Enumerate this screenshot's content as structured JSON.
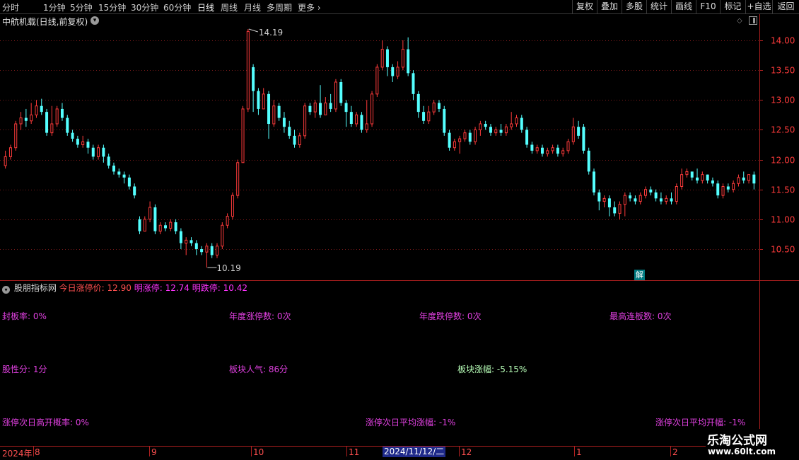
{
  "toolbar": {
    "periods": [
      "分时",
      "1分钟",
      "5分钟",
      "15分钟",
      "30分钟",
      "60分钟",
      "日线",
      "周线",
      "月线",
      "多周期",
      "更多"
    ],
    "active_period": "日线",
    "buttons": [
      "复权",
      "叠加",
      "多股",
      "统计",
      "画线",
      "F10",
      "标记",
      "+自选",
      "返回"
    ]
  },
  "chart": {
    "title": "中航机载(日线,前复权)",
    "high_label": "14.19",
    "low_label": "10.19"
  },
  "indicator": {
    "name": "股朋指标网",
    "today_limit": "今日涨停价: 12.90",
    "tomorrow_limit_up": "明涨停: 12.74",
    "tomorrow_limit_down": "明跌停: 10.42",
    "stats": {
      "seal_rate": "封板率: 0%",
      "annual_limit_up": "年度涨停数: 0次",
      "annual_limit_down": "年度跌停数: 0次",
      "max_consecutive": "最高连板数: 0次",
      "stock_character": "股性分: 1分",
      "sector_popularity": "板块人气: 86分",
      "sector_change": "板块涨幅: -5.15%",
      "next_day_gap_up_rate": "涨停次日高开概率: 0%",
      "next_day_avg_change": "涨停次日平均涨幅: -1%",
      "next_day_avg_open": "涨停次日平均开幅: -1%"
    },
    "badge": "解"
  },
  "time_axis": {
    "labels": [
      "2024年",
      "8",
      "9",
      "10",
      "11",
      "12",
      "1",
      "2"
    ],
    "cursor_date": "2024/11/12/二"
  },
  "watermark": {
    "title": "乐淘公式网",
    "url": "www.60lt.com"
  },
  "colors": {
    "up": "#ff3b3b",
    "down": "#54ffff",
    "axis": "#b02020",
    "grid": "#7a1a1a"
  },
  "chart_data": {
    "type": "candlestick",
    "title": "中航机载(日线,前复权)",
    "ylim": [
      10.0,
      14.3
    ],
    "yticks": [
      10.5,
      11.0,
      11.5,
      12.0,
      12.5,
      13.0,
      13.5,
      14.0
    ],
    "x_month_labels": [
      "2024年",
      "8",
      "9",
      "10",
      "11",
      "12",
      "1",
      "2"
    ],
    "annotations": [
      {
        "text": "14.19",
        "value": 14.19
      },
      {
        "text": "10.19",
        "value": 10.19
      }
    ],
    "candles": [
      [
        11.9,
        12.05,
        11.85,
        12.15
      ],
      [
        12.05,
        12.2,
        12.0,
        12.25
      ],
      [
        12.2,
        12.6,
        12.15,
        12.65
      ],
      [
        12.6,
        12.7,
        12.5,
        12.8
      ],
      [
        12.7,
        12.65,
        12.55,
        12.85
      ],
      [
        12.65,
        12.75,
        12.6,
        12.95
      ],
      [
        12.75,
        12.9,
        12.7,
        13.0
      ],
      [
        12.9,
        12.8,
        12.75,
        13.02
      ],
      [
        12.8,
        12.45,
        12.4,
        12.85
      ],
      [
        12.45,
        12.6,
        12.4,
        12.9
      ],
      [
        12.6,
        12.85,
        12.55,
        12.9
      ],
      [
        12.85,
        12.7,
        12.65,
        12.95
      ],
      [
        12.7,
        12.45,
        12.4,
        12.75
      ],
      [
        12.45,
        12.35,
        12.3,
        12.5
      ],
      [
        12.35,
        12.25,
        12.2,
        12.4
      ],
      [
        12.25,
        12.3,
        12.2,
        12.4
      ],
      [
        12.3,
        12.2,
        12.1,
        12.35
      ],
      [
        12.2,
        12.05,
        12.0,
        12.25
      ],
      [
        12.05,
        12.2,
        12.0,
        12.25
      ],
      [
        12.2,
        12.05,
        11.95,
        12.25
      ],
      [
        12.05,
        11.9,
        11.85,
        12.1
      ],
      [
        11.9,
        11.8,
        11.75,
        11.95
      ],
      [
        11.8,
        11.75,
        11.7,
        11.85
      ],
      [
        11.75,
        11.7,
        11.6,
        11.8
      ],
      [
        11.7,
        11.55,
        11.5,
        11.75
      ],
      [
        11.55,
        11.4,
        11.35,
        11.6
      ],
      [
        11.0,
        10.8,
        10.75,
        11.05
      ],
      [
        10.8,
        11.0,
        10.8,
        11.05
      ],
      [
        11.0,
        11.2,
        10.95,
        11.3
      ],
      [
        11.2,
        10.8,
        10.75,
        11.25
      ],
      [
        10.8,
        10.9,
        10.75,
        10.95
      ],
      [
        10.9,
        10.85,
        10.8,
        10.95
      ],
      [
        10.85,
        10.95,
        10.8,
        11.0
      ],
      [
        10.95,
        10.8,
        10.75,
        11.0
      ],
      [
        10.8,
        10.6,
        10.5,
        10.85
      ],
      [
        10.6,
        10.65,
        10.4,
        10.7
      ],
      [
        10.65,
        10.6,
        10.55,
        10.7
      ],
      [
        10.6,
        10.5,
        10.4,
        10.65
      ],
      [
        10.5,
        10.45,
        10.4,
        10.55
      ],
      [
        10.45,
        10.55,
        10.19,
        10.6
      ],
      [
        10.55,
        10.4,
        10.35,
        10.6
      ],
      [
        10.4,
        10.55,
        10.35,
        10.6
      ],
      [
        10.55,
        10.9,
        10.5,
        10.95
      ],
      [
        10.9,
        11.05,
        10.85,
        11.1
      ],
      [
        11.05,
        11.4,
        11.0,
        11.45
      ],
      [
        11.4,
        11.95,
        11.35,
        12.0
      ],
      [
        11.95,
        12.85,
        12.4,
        12.9
      ],
      [
        12.85,
        14.15,
        12.8,
        14.19
      ],
      [
        13.55,
        13.15,
        12.8,
        13.6
      ],
      [
        13.15,
        12.85,
        12.75,
        13.2
      ],
      [
        12.85,
        13.1,
        12.85,
        13.2
      ],
      [
        13.1,
        12.6,
        12.35,
        13.15
      ],
      [
        12.6,
        12.9,
        12.55,
        13.0
      ],
      [
        12.9,
        12.7,
        12.65,
        12.95
      ],
      [
        12.7,
        12.55,
        12.45,
        12.8
      ],
      [
        12.55,
        12.4,
        12.35,
        12.65
      ],
      [
        12.4,
        12.25,
        12.2,
        12.5
      ],
      [
        12.25,
        12.4,
        12.2,
        12.45
      ],
      [
        12.4,
        12.9,
        12.35,
        12.95
      ],
      [
        12.9,
        12.8,
        12.75,
        12.95
      ],
      [
        12.8,
        12.95,
        12.7,
        13.0
      ],
      [
        12.95,
        12.75,
        12.7,
        13.25
      ],
      [
        12.75,
        12.95,
        12.75,
        13.05
      ],
      [
        12.95,
        12.85,
        12.8,
        13.1
      ],
      [
        12.85,
        13.3,
        12.8,
        13.35
      ],
      [
        13.3,
        12.95,
        12.9,
        13.35
      ],
      [
        12.95,
        12.8,
        12.55,
        13.0
      ],
      [
        12.8,
        12.6,
        12.55,
        12.9
      ],
      [
        12.6,
        12.75,
        12.55,
        12.8
      ],
      [
        12.75,
        12.5,
        12.45,
        12.8
      ],
      [
        12.5,
        12.6,
        12.45,
        13.0
      ],
      [
        12.6,
        13.1,
        12.55,
        13.15
      ],
      [
        13.1,
        13.55,
        13.05,
        13.6
      ],
      [
        13.55,
        13.85,
        13.5,
        14.0
      ],
      [
        13.85,
        13.55,
        13.4,
        13.9
      ],
      [
        13.55,
        13.4,
        13.3,
        13.6
      ],
      [
        13.4,
        13.55,
        13.35,
        13.65
      ],
      [
        13.55,
        13.85,
        13.5,
        14.0
      ],
      [
        13.85,
        13.45,
        13.4,
        14.05
      ],
      [
        13.45,
        13.1,
        13.0,
        13.5
      ],
      [
        13.1,
        12.8,
        12.7,
        13.15
      ],
      [
        12.8,
        12.65,
        12.6,
        12.9
      ],
      [
        12.65,
        12.8,
        12.6,
        12.9
      ],
      [
        12.8,
        12.95,
        12.75,
        13.0
      ],
      [
        12.95,
        12.85,
        12.8,
        13.0
      ],
      [
        12.85,
        12.45,
        12.4,
        12.9
      ],
      [
        12.45,
        12.2,
        12.15,
        12.5
      ],
      [
        12.2,
        12.3,
        12.15,
        12.35
      ],
      [
        12.3,
        12.35,
        12.1,
        12.4
      ],
      [
        12.35,
        12.45,
        12.3,
        12.5
      ],
      [
        12.45,
        12.3,
        12.25,
        12.5
      ],
      [
        12.3,
        12.5,
        12.25,
        12.55
      ],
      [
        12.5,
        12.6,
        12.4,
        12.65
      ],
      [
        12.6,
        12.55,
        12.5,
        12.65
      ],
      [
        12.55,
        12.45,
        12.4,
        12.6
      ],
      [
        12.45,
        12.5,
        12.4,
        12.55
      ],
      [
        12.5,
        12.45,
        12.4,
        12.6
      ],
      [
        12.45,
        12.55,
        12.4,
        12.6
      ],
      [
        12.55,
        12.6,
        12.5,
        12.8
      ],
      [
        12.6,
        12.7,
        12.55,
        12.75
      ],
      [
        12.7,
        12.5,
        12.45,
        12.75
      ],
      [
        12.5,
        12.25,
        12.2,
        12.55
      ],
      [
        12.25,
        12.15,
        12.1,
        12.3
      ],
      [
        12.15,
        12.2,
        12.1,
        12.25
      ],
      [
        12.2,
        12.1,
        12.05,
        12.25
      ],
      [
        12.1,
        12.15,
        12.05,
        12.2
      ],
      [
        12.15,
        12.2,
        12.1,
        12.25
      ],
      [
        12.2,
        12.1,
        12.05,
        12.25
      ],
      [
        12.1,
        12.15,
        12.05,
        12.2
      ],
      [
        12.15,
        12.3,
        12.1,
        12.35
      ],
      [
        12.3,
        12.55,
        12.25,
        12.7
      ],
      [
        12.55,
        12.4,
        12.35,
        12.65
      ],
      [
        12.55,
        12.15,
        12.1,
        12.6
      ],
      [
        12.15,
        11.8,
        11.75,
        12.2
      ],
      [
        11.8,
        11.45,
        11.4,
        11.85
      ],
      [
        11.45,
        11.3,
        11.15,
        11.5
      ],
      [
        11.3,
        11.35,
        11.2,
        11.4
      ],
      [
        11.35,
        11.2,
        11.05,
        11.4
      ],
      [
        11.2,
        11.1,
        11.05,
        11.3
      ],
      [
        11.1,
        11.25,
        11.0,
        11.3
      ],
      [
        11.25,
        11.4,
        11.05,
        11.45
      ],
      [
        11.4,
        11.35,
        11.3,
        11.45
      ],
      [
        11.35,
        11.3,
        11.25,
        11.4
      ],
      [
        11.3,
        11.4,
        11.25,
        11.45
      ],
      [
        11.4,
        11.5,
        11.35,
        11.55
      ],
      [
        11.5,
        11.45,
        11.4,
        11.55
      ],
      [
        11.45,
        11.35,
        11.3,
        11.5
      ],
      [
        11.35,
        11.3,
        11.25,
        11.45
      ],
      [
        11.3,
        11.35,
        11.25,
        11.4
      ],
      [
        11.35,
        11.3,
        11.25,
        11.45
      ],
      [
        11.3,
        11.55,
        11.25,
        11.6
      ],
      [
        11.55,
        11.75,
        11.5,
        11.85
      ],
      [
        11.75,
        11.8,
        11.7,
        11.85
      ],
      [
        11.8,
        11.7,
        11.65,
        11.8
      ],
      [
        11.7,
        11.65,
        11.6,
        11.85
      ],
      [
        11.65,
        11.75,
        11.6,
        11.8
      ],
      [
        11.75,
        11.65,
        11.6,
        11.75
      ],
      [
        11.65,
        11.6,
        11.55,
        11.7
      ],
      [
        11.6,
        11.4,
        11.35,
        11.65
      ],
      [
        11.4,
        11.55,
        11.35,
        11.6
      ],
      [
        11.55,
        11.5,
        11.45,
        11.6
      ],
      [
        11.5,
        11.6,
        11.45,
        11.65
      ],
      [
        11.6,
        11.7,
        11.55,
        11.75
      ],
      [
        11.7,
        11.65,
        11.6,
        11.8
      ],
      [
        11.65,
        11.75,
        11.6,
        11.75
      ],
      [
        11.75,
        11.6,
        11.5,
        11.8
      ]
    ]
  }
}
